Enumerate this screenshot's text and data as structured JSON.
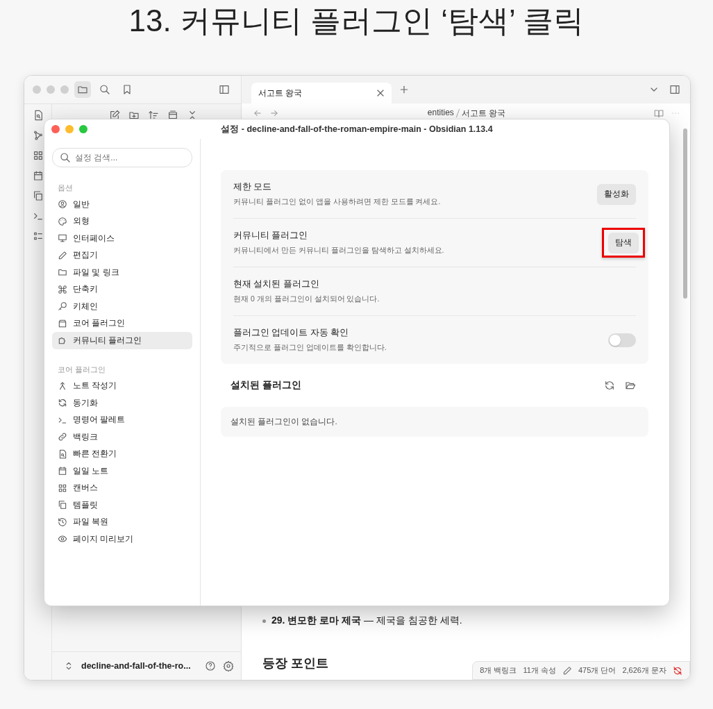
{
  "caption": "13. 커뮤니티 플러그인 ‘탐색’ 클릭",
  "window": {
    "tabs": [
      {
        "label": "서고트 왕국",
        "selected": true
      }
    ],
    "breadcrumb": [
      "entities",
      "서고트 왕국"
    ],
    "vault": "decline-and-fall-of-the-ro...",
    "note": {
      "bullet": "**29. 변모한 로마 제국** — 제국을 침공한 세력.",
      "heading": "등장 포인트"
    },
    "status_bar": [
      "8개 백링크",
      "11개 속성",
      "475개 단어",
      "2,626개 문자"
    ]
  },
  "settings": {
    "title": "설정 - decline-and-fall-of-the-roman-empire-main - Obsidian 1.13.4",
    "search": {
      "placeholder": "설정 검색..."
    },
    "groups": [
      {
        "heading": "옵션",
        "items": [
          {
            "label": "일반",
            "selected": false
          },
          {
            "label": "외형",
            "selected": false
          },
          {
            "label": "인터페이스",
            "selected": false
          },
          {
            "label": "편집기",
            "selected": false
          },
          {
            "label": "파일 및 링크",
            "selected": false
          },
          {
            "label": "단축키",
            "selected": false
          },
          {
            "label": "키체인",
            "selected": false
          },
          {
            "label": "코어 플러그인",
            "selected": false
          },
          {
            "label": "커뮤니티 플러그인",
            "selected": true
          }
        ]
      },
      {
        "heading": "코어 플러그인",
        "items": [
          {
            "label": "노트 작성기",
            "selected": false
          },
          {
            "label": "동기화",
            "selected": false
          },
          {
            "label": "명령어 팔레트",
            "selected": false
          },
          {
            "label": "백링크",
            "selected": false
          },
          {
            "label": "빠른 전환기",
            "selected": false
          },
          {
            "label": "일일 노트",
            "selected": false
          },
          {
            "label": "캔버스",
            "selected": false
          },
          {
            "label": "템플릿",
            "selected": false
          },
          {
            "label": "파일 복원",
            "selected": false
          },
          {
            "label": "페이지 미리보기",
            "selected": false
          }
        ]
      }
    ],
    "options": [
      {
        "kind": "button",
        "title": "제한 모드",
        "description": "커뮤니티 플러그인 없이 앱을 사용하려면 제한 모드를 켜세요.",
        "button": "활성화",
        "highlighted": false
      },
      {
        "kind": "button",
        "title": "커뮤니티 플러그인",
        "description": "커뮤니티에서 만든 커뮤니티 플러그인을 탐색하고 설치하세요.",
        "button": "탐색",
        "highlighted": true
      },
      {
        "kind": "text",
        "title": "현재 설치된 플러그인",
        "description": "현재 0 개의 플러그인이 설치되어 있습니다."
      },
      {
        "kind": "toggle",
        "title": "플러그인 업데이트 자동 확인",
        "description": "주기적으로 플러그인 업데이트를 확인합니다.",
        "on": false
      }
    ],
    "installed": {
      "heading": "설치된 플러그인",
      "empty": "설치된 플러그인이 없습니다."
    }
  }
}
